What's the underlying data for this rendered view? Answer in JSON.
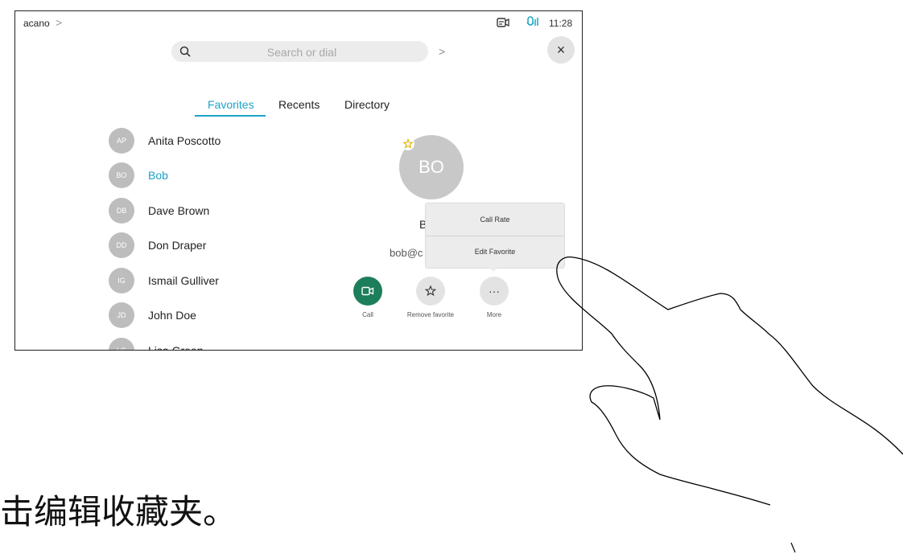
{
  "status_bar": {
    "title": "acano",
    "chevron": ">",
    "time": "11:28",
    "video_icon": "video-status-icon",
    "mic_icon": "mic-status-icon"
  },
  "search": {
    "placeholder": "Search or dial",
    "go_icon": ">"
  },
  "close_label": "×",
  "tabs": [
    {
      "label": "Favorites",
      "active": true
    },
    {
      "label": "Recents",
      "active": false
    },
    {
      "label": "Directory",
      "active": false
    }
  ],
  "contacts": [
    {
      "initials": "AP",
      "name": "Anita Poscotto",
      "selected": false
    },
    {
      "initials": "BO",
      "name": "Bob",
      "selected": true
    },
    {
      "initials": "DB",
      "name": "Dave Brown",
      "selected": false
    },
    {
      "initials": "DD",
      "name": "Don Draper",
      "selected": false
    },
    {
      "initials": "IG",
      "name": "Ismail Gulliver",
      "selected": false
    },
    {
      "initials": "JD",
      "name": "John Doe",
      "selected": false
    },
    {
      "initials": "LG",
      "name": "Lisa Green",
      "selected": false
    }
  ],
  "detail": {
    "initials": "BO",
    "name_visible": "B",
    "email_visible": "bob@c",
    "favorite": true
  },
  "popover": {
    "items": [
      "Call Rate",
      "Edit Favorite"
    ]
  },
  "actions": [
    {
      "label": "Call",
      "icon": "video-camera-icon"
    },
    {
      "label": "Remove favorite",
      "icon": "star-outline-icon"
    },
    {
      "label": "More",
      "icon": "ellipsis-icon",
      "glyph": "···"
    }
  ],
  "caption": "点击编辑收藏夹。",
  "colors": {
    "accent": "#1ca3c7",
    "call_green": "#1d7e5b",
    "avatar_gray": "#bdbdbd"
  }
}
